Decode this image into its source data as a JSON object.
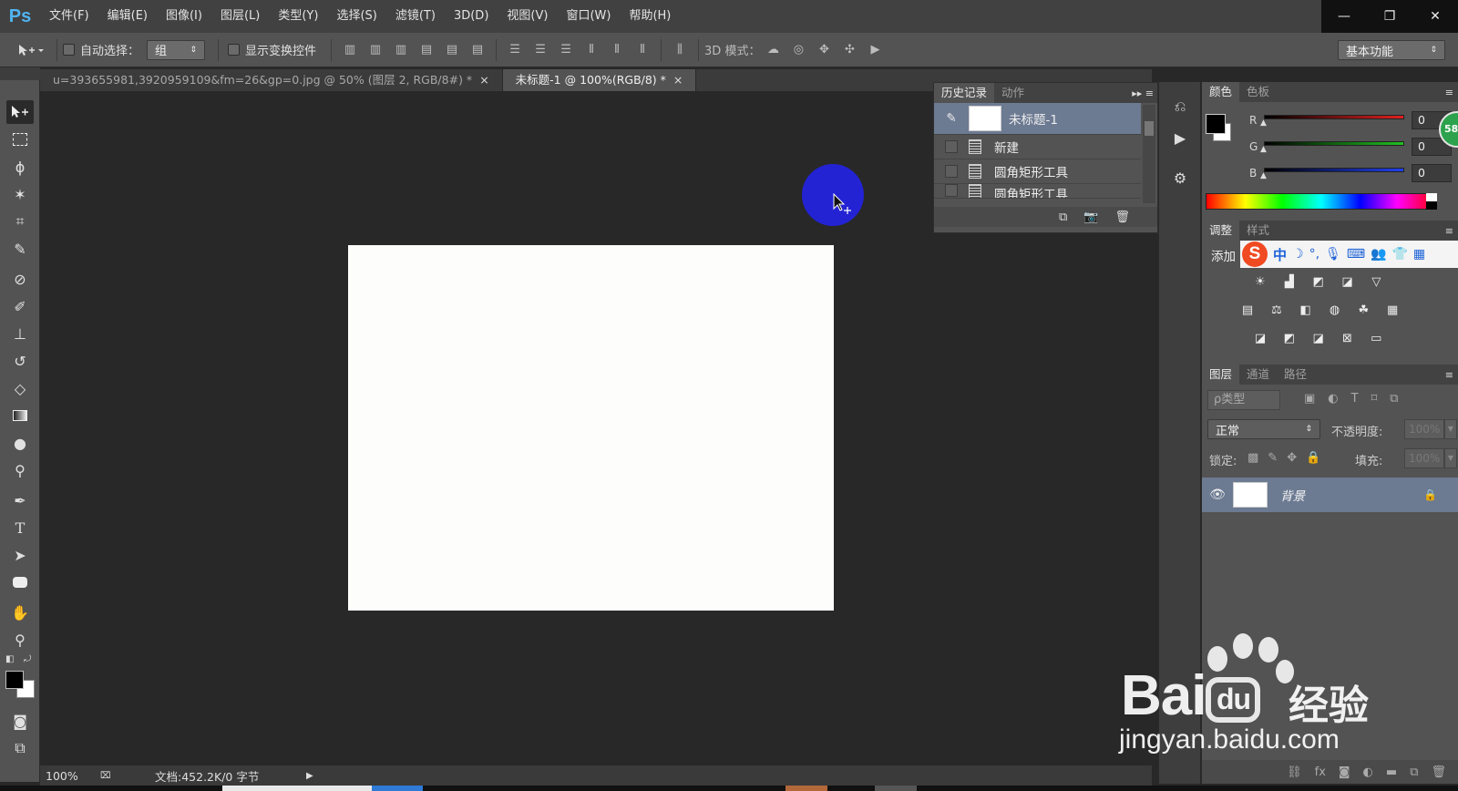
{
  "app": {
    "logo": "Ps"
  },
  "menu": [
    "文件(F)",
    "编辑(E)",
    "图像(I)",
    "图层(L)",
    "类型(Y)",
    "选择(S)",
    "滤镜(T)",
    "3D(D)",
    "视图(V)",
    "窗口(W)",
    "帮助(H)"
  ],
  "window_controls": {
    "minimize": "—",
    "restore": "❐",
    "close": "✕"
  },
  "options": {
    "auto_select_label": "自动选择：",
    "auto_select_value": "组",
    "show_transform_label": "显示变换控件",
    "mode_3d_label": "3D 模式：",
    "workspace": "基本功能"
  },
  "tabs": [
    {
      "label": "u=393655981,3920959109&fm=26&gp=0.jpg @ 50% (图层 2, RGB/8#) *",
      "close": "×"
    },
    {
      "label": "未标题-1 @ 100%(RGB/8) *",
      "close": "×"
    }
  ],
  "status": {
    "zoom": "100%",
    "doc": "文档:452.2K/0 字节"
  },
  "history": {
    "tabs": [
      "历史记录",
      "动作"
    ],
    "snapshot": "未标题-1",
    "items": [
      "新建",
      "圆角矩形工具",
      "圆角矩形工具"
    ]
  },
  "color_panel": {
    "tabs": [
      "颜色",
      "色板"
    ],
    "channels": [
      {
        "name": "R",
        "value": "0"
      },
      {
        "name": "G",
        "value": "0"
      },
      {
        "name": "B",
        "value": "0"
      }
    ],
    "colors": {
      "r": "#d62020",
      "g": "#22b522",
      "b": "#2244dd"
    }
  },
  "adjust_panel": {
    "tabs": [
      "调整",
      "样式"
    ],
    "add_label": "添加",
    "ime_text": "中"
  },
  "layers_panel": {
    "tabs": [
      "图层",
      "通道",
      "路径"
    ],
    "filter": "ρ类型",
    "blend_mode": "正常",
    "opacity_label": "不透明度:",
    "opacity_value": "100%",
    "lock_label": "锁定:",
    "fill_label": "填充:",
    "fill_value": "100%",
    "layers": [
      {
        "name": "背景"
      }
    ]
  },
  "badge": "58",
  "watermark": {
    "brand": "Bai",
    "du": "du",
    "cn": "经验",
    "url": "jingyan.baidu.com"
  }
}
